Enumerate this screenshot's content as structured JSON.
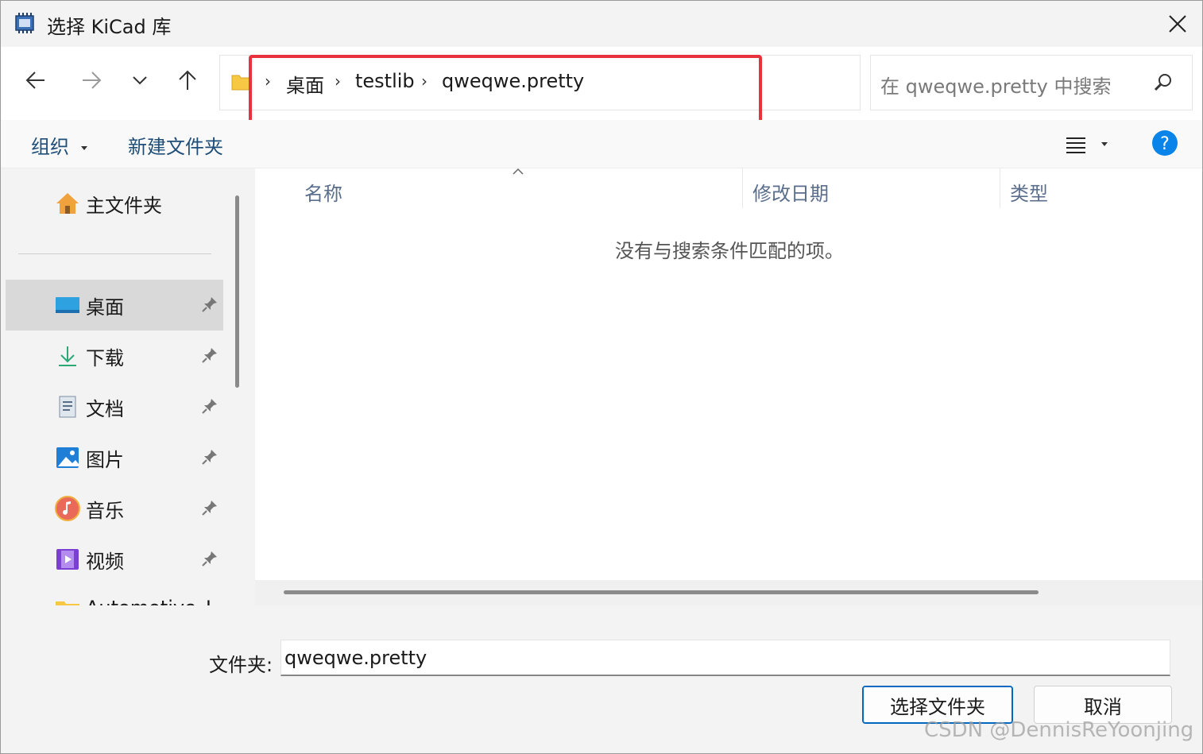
{
  "window": {
    "title": "选择 KiCad 库"
  },
  "address": {
    "breadcrumbs": [
      "桌面",
      "testlib",
      "qweqwe.pretty"
    ],
    "separator": "›"
  },
  "search": {
    "placeholder": "在 qweqwe.pretty 中搜索"
  },
  "toolbar": {
    "organize": "组织",
    "new_folder": "新建文件夹"
  },
  "sidebar": {
    "home": "主文件夹",
    "items": [
      {
        "label": "桌面",
        "icon": "desktop-icon",
        "pinned": true,
        "selected": true
      },
      {
        "label": "下载",
        "icon": "download-icon",
        "pinned": true
      },
      {
        "label": "文档",
        "icon": "documents-icon",
        "pinned": true
      },
      {
        "label": "图片",
        "icon": "pictures-icon",
        "pinned": true
      },
      {
        "label": "音乐",
        "icon": "music-icon",
        "pinned": true
      },
      {
        "label": "视频",
        "icon": "videos-icon",
        "pinned": true
      }
    ],
    "partial_item": "Automotive_I"
  },
  "file_list": {
    "columns": [
      "名称",
      "修改日期",
      "类型"
    ],
    "empty_message": "没有与搜索条件匹配的项。"
  },
  "footer": {
    "folder_label": "文件夹:",
    "folder_value": "qweqwe.pretty",
    "select_button": "选择文件夹",
    "cancel_button": "取消"
  },
  "watermark": "CSDN @DennisReYoonjing",
  "colors": {
    "highlight": "#e8333f",
    "accent": "#0067c0",
    "help": "#0a84e8"
  }
}
